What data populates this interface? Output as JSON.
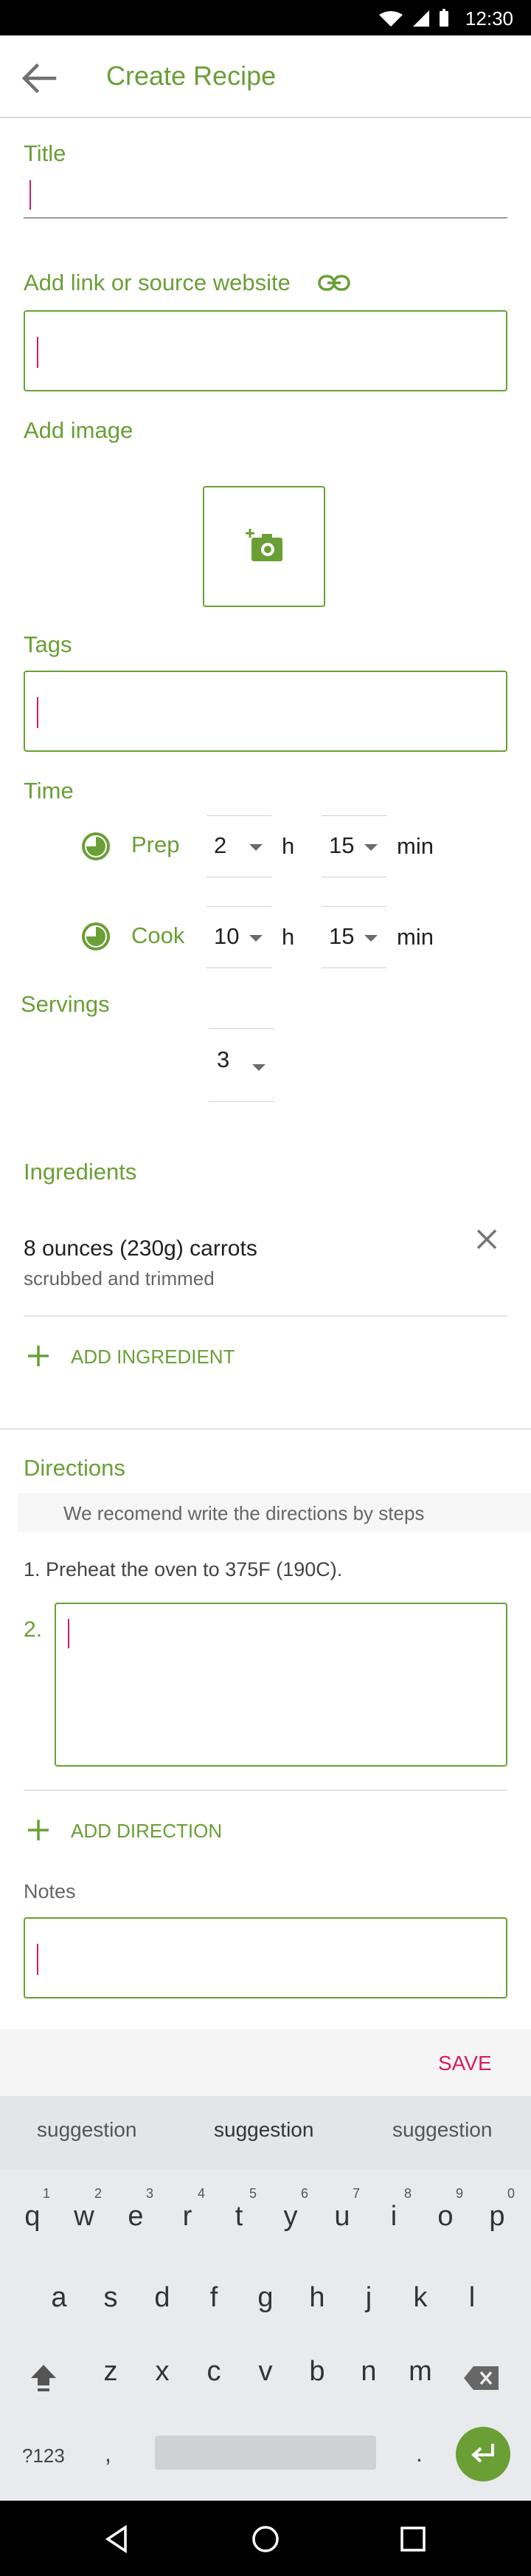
{
  "status": {
    "time": "12:30"
  },
  "appbar": {
    "title": "Create Recipe"
  },
  "title_field": {
    "label": "Title",
    "value": ""
  },
  "link_field": {
    "label": "Add link or source website",
    "value": ""
  },
  "image": {
    "label": "Add image"
  },
  "tags": {
    "label": "Tags",
    "value": ""
  },
  "time": {
    "label": "Time",
    "prep": {
      "label": "Prep",
      "hours": "2",
      "hours_unit": "h",
      "minutes": "15",
      "minutes_unit": "min"
    },
    "cook": {
      "label": "Cook",
      "hours": "10",
      "hours_unit": "h",
      "minutes": "15",
      "minutes_unit": "min"
    }
  },
  "servings": {
    "label": "Servings",
    "value": "3"
  },
  "ingredients": {
    "label": "Ingredients",
    "items": [
      {
        "name": "8 ounces (230g) carrots",
        "note": "scrubbed and trimmed"
      }
    ],
    "add_label": "ADD INGREDIENT"
  },
  "directions": {
    "label": "Directions",
    "hint": "We recomend write the directions by steps",
    "steps": [
      "1. Preheat the oven to 375F (190C)."
    ],
    "next_number": "2.",
    "add_label": "ADD DIRECTION"
  },
  "notes": {
    "label": "Notes",
    "value": ""
  },
  "save_label": "SAVE",
  "keyboard": {
    "suggestions": [
      "suggestion",
      "suggestion",
      "suggestion"
    ],
    "row1": [
      "q",
      "w",
      "e",
      "r",
      "t",
      "y",
      "u",
      "i",
      "o",
      "p"
    ],
    "row1_nums": [
      "1",
      "2",
      "3",
      "4",
      "5",
      "6",
      "7",
      "8",
      "9",
      "0"
    ],
    "row2": [
      "a",
      "s",
      "d",
      "f",
      "g",
      "h",
      "j",
      "k",
      "l"
    ],
    "row3": [
      "z",
      "x",
      "c",
      "v",
      "b",
      "n",
      "m"
    ],
    "symbols_key": "?123",
    "comma_key": ",",
    "period_key": "."
  },
  "colors": {
    "accent": "#6a9f36",
    "save": "#d81b60"
  }
}
